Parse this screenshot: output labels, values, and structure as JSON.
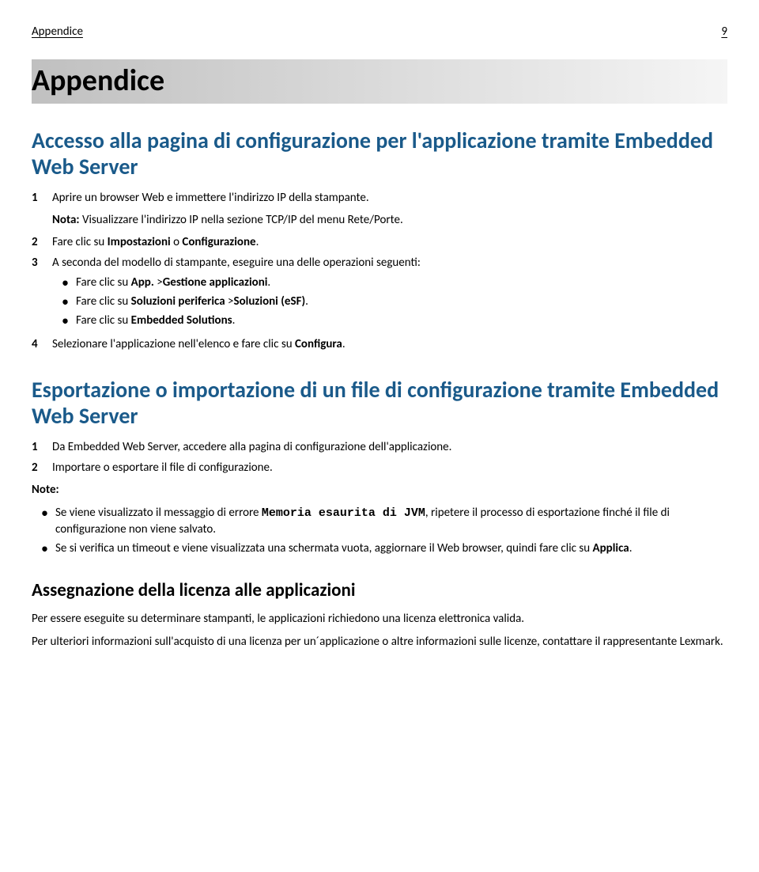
{
  "header": {
    "left": "Appendice",
    "right": "9"
  },
  "h1": "Appendice",
  "s1": {
    "h2": "Accesso alla pagina di configurazione per l'applicazione tramite Embedded Web Server",
    "step1_num": "1",
    "step1": "Aprire un browser Web e immettere l'indirizzo IP della stampante.",
    "note_label": "Nota:",
    "note_text": " Visualizzare l'indirizzo IP nella sezione TCP/IP del menu Rete/Porte.",
    "step2_num": "2",
    "step2_a": "Fare clic su ",
    "step2_b": "Impostazioni",
    "step2_c": " o ",
    "step2_d": "Configurazione",
    "step2_e": ".",
    "step3_num": "3",
    "step3": "A seconda del modello di stampante, eseguire una delle operazioni seguenti:",
    "b1_a": "Fare clic su ",
    "b1_b": "App.",
    "b1_c": " >",
    "b1_d": "Gestione applicazioni",
    "b1_e": ".",
    "b2_a": "Fare clic su ",
    "b2_b": "Soluzioni periferica",
    "b2_c": " >",
    "b2_d": "Soluzioni (eSF)",
    "b2_e": ".",
    "b3_a": "Fare clic su ",
    "b3_b": "Embedded Solutions",
    "b3_c": ".",
    "step4_num": "4",
    "step4_a": "Selezionare l'applicazione nell'elenco e fare clic su ",
    "step4_b": "Configura",
    "step4_c": "."
  },
  "s2": {
    "h2": "Esportazione o importazione di un file di configurazione tramite Embedded Web Server",
    "step1_num": "1",
    "step1": "Da Embedded Web Server, accedere alla pagina di configurazione dell'applicazione.",
    "step2_num": "2",
    "step2": "Importare o esportare il file di configurazione.",
    "notes_label": "Note:",
    "nb1_a": "Se viene visualizzato il messaggio di errore ",
    "nb1_mono": "Memoria esaurita di JVM",
    "nb1_b": ", ripetere il processo di esportazione finché il file di configurazione non viene salvato.",
    "nb2_a": "Se si verifica un timeout e viene visualizzata una schermata vuota, aggiornare il Web browser, quindi fare clic su ",
    "nb2_b": "Applica",
    "nb2_c": "."
  },
  "s3": {
    "h3": "Assegnazione della licenza alle applicazioni",
    "p1": "Per essere eseguite su determinare stampanti, le applicazioni richiedono una licenza elettronica valida.",
    "p2": "Per ulteriori informazioni sull'acquisto di una licenza per un´applicazione o altre informazioni sulle licenze, contattare il rappresentante Lexmark."
  }
}
